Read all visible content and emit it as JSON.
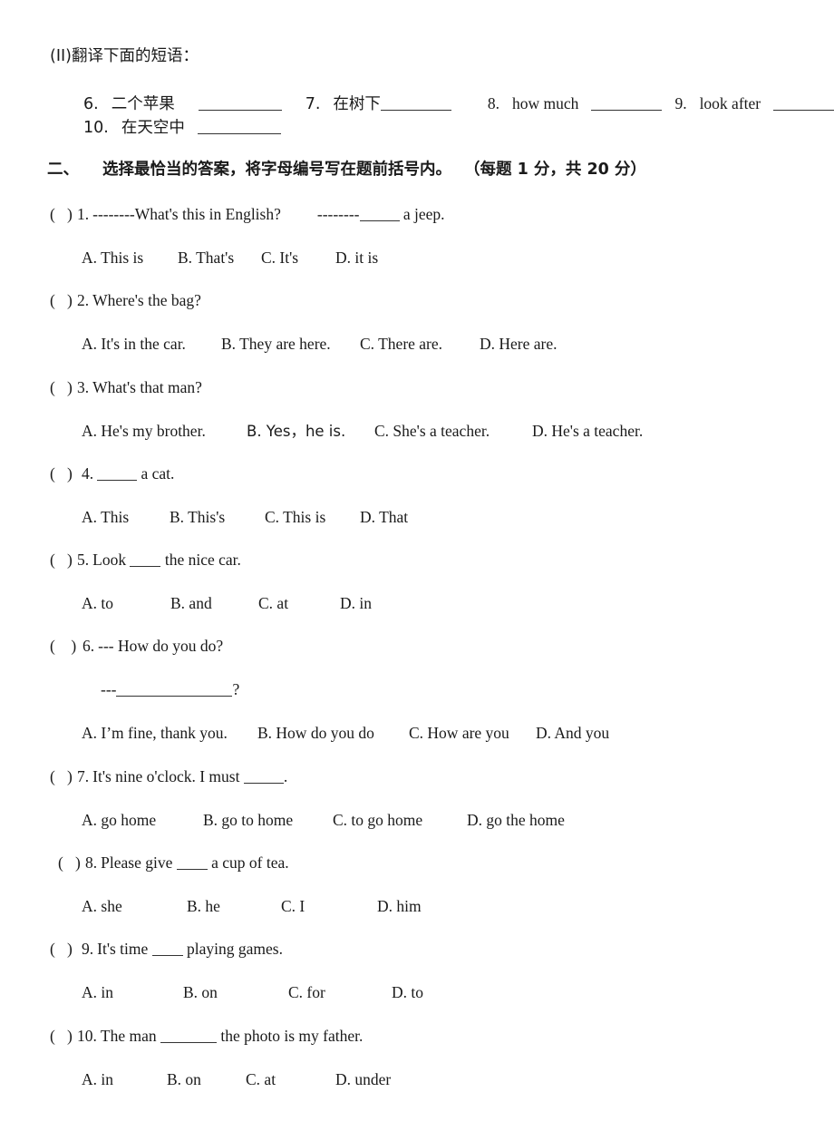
{
  "document": {
    "part_one": {
      "instruction": "(II)翻译下面的短语：",
      "items": [
        {
          "number": "6.",
          "text": "二个苹果"
        },
        {
          "number": "7.",
          "text": "在树下"
        },
        {
          "number": "8.",
          "text": "how much"
        },
        {
          "number": "9.",
          "text": "look after"
        },
        {
          "number": "10.",
          "text": "在天空中"
        }
      ]
    },
    "part_two": {
      "marker": "二、",
      "heading": "选择最恰当的答案，将字母编号写在题前括号内。",
      "score_note": "（每题 1 分，共 20 分）",
      "questions": [
        {
          "number": "1.",
          "stem": "--------What's this in English?",
          "stem_tail": "--------",
          "stem_after_blank": " a jeep.",
          "options": [
            "A. This is",
            "B. That's",
            "C. It's",
            "D. it is"
          ]
        },
        {
          "number": "2.",
          "stem": "Where's the bag?",
          "options": [
            "A. It's in the car.",
            "B. They are here.",
            "C. There are.",
            "D. Here are."
          ]
        },
        {
          "number": "3.",
          "stem": "What's that man?",
          "options": [
            "A. He's my brother.",
            "B. Yes，he is.",
            "C. She's a teacher.",
            "D. He's a teacher."
          ]
        },
        {
          "number": "4.",
          "stem_before_blank": "",
          "stem_after_blank": " a cat.",
          "options": [
            "A. This",
            "B. This's",
            "C. This is",
            "D. That"
          ]
        },
        {
          "number": "5.",
          "stem_before_blank": "Look ",
          "stem_after_blank": " the nice car.",
          "options": [
            "A. to",
            "B. and",
            "C. at",
            "D. in"
          ]
        },
        {
          "number": "6.",
          "stem": "--- How do you do?",
          "sub_line_prefix": "---",
          "sub_line_suffix": "?",
          "options": [
            "A. I’m fine, thank you.",
            "B. How do you do",
            "C. How are you",
            "D. And you"
          ]
        },
        {
          "number": "7.",
          "stem_before_blank": "It's nine o'clock. I must ",
          "stem_after_blank": ".",
          "options": [
            "A. go home",
            "B. go to home",
            "C. to go home",
            "D. go the home"
          ]
        },
        {
          "number": "8.",
          "stem_before_blank": "Please give ",
          "stem_after_blank": " a cup of tea.",
          "options": [
            "A. she",
            "B. he",
            "C. I",
            "D. him"
          ]
        },
        {
          "number": "9.",
          "stem_before_blank": "It's time ",
          "stem_after_blank": " playing games.",
          "options": [
            "A. in",
            "B. on",
            "C. for",
            "D. to"
          ]
        },
        {
          "number": "10.",
          "stem_before_blank": "The man ",
          "stem_after_blank": " the photo is my father.",
          "options": [
            "A. in",
            "B. on",
            "C. at",
            "D. under"
          ]
        }
      ]
    }
  }
}
